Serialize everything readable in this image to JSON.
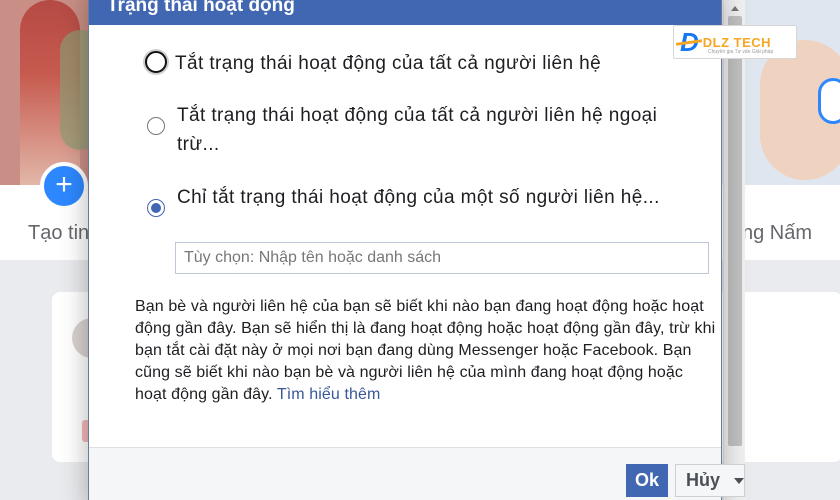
{
  "background": {
    "create_story_label": "Tạo tin",
    "friend_name_partial": "ng Nấm",
    "add_icon": "plus-icon"
  },
  "dialog": {
    "title": "Trạng thái hoạt động",
    "options": [
      {
        "label": "Tắt trạng thái hoạt động của tất cả người liên hệ",
        "selected": false,
        "focused": true
      },
      {
        "label": "Tắt trạng thái hoạt động của tất cả người liên hệ ngoại trừ...",
        "selected": false,
        "focused": false
      },
      {
        "label": "Chỉ tắt trạng thái hoạt động của một số người liên hệ...",
        "selected": true,
        "focused": false
      }
    ],
    "input_placeholder": "Tùy chọn: Nhập tên hoặc danh sách",
    "input_value": "",
    "description": "Bạn bè và người liên hệ của bạn sẽ biết khi nào bạn đang hoạt động hoặc hoạt động gần đây. Bạn sẽ hiển thị là đang hoạt động hoặc hoạt động gần đây, trừ khi bạn tắt cài đặt này ở mọi nơi bạn đang dùng Messenger hoặc Facebook. Bạn cũng sẽ biết khi nào bạn bè và người liên hệ của mình đang hoạt động hoặc hoạt động gần đây.",
    "learn_more": "Tìm hiểu thêm",
    "ok_label": "Ok",
    "cancel_label": "Hủy"
  },
  "watermark": {
    "mark": "D",
    "text": "DLZ TECH",
    "tagline": "Chuyên gia Tư vấn Giải pháp"
  },
  "colors": {
    "facebook_blue": "#4267b2",
    "link": "#385898",
    "logo_blue": "#1877f2",
    "logo_orange": "#f5a623"
  }
}
